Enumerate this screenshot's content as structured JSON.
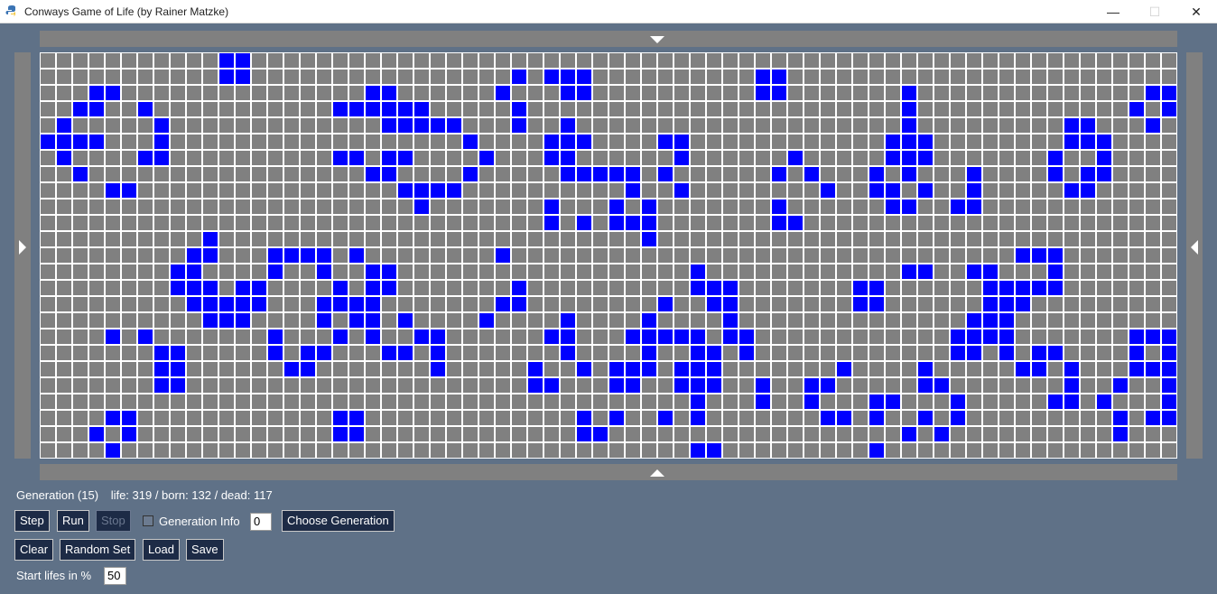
{
  "window": {
    "title": "Conways Game of Life (by Rainer Matzke)",
    "minimize": "—",
    "maximize": "☐",
    "close": "✕"
  },
  "colors": {
    "alive": "#0000ff",
    "dead": "#808080",
    "grid_line": "#ffffff",
    "background": "#5f7187",
    "button": "#1d2b46"
  },
  "board": {
    "cols": 70,
    "rows": 25,
    "cells": [
      "..........................................................................",
      ".........",
      "",
      "",
      "",
      "",
      "",
      "",
      "",
      "",
      "",
      "",
      "",
      "",
      "",
      "",
      "",
      "",
      "",
      "",
      "",
      "",
      "",
      "",
      ""
    ]
  },
  "status": {
    "generation": "Generation (15)",
    "counts": "life: 319 / born: 132 / dead: 117"
  },
  "controls": {
    "step": "Step",
    "run": "Run",
    "stop": "Stop",
    "generation_info": "Generation Info",
    "generation_value": "0",
    "choose_generation": "Choose Generation",
    "clear": "Clear",
    "random_set": "Random Set",
    "load": "Load",
    "save": "Save",
    "start_lifes_label": "Start lifes in %",
    "start_lifes_value": "50"
  }
}
